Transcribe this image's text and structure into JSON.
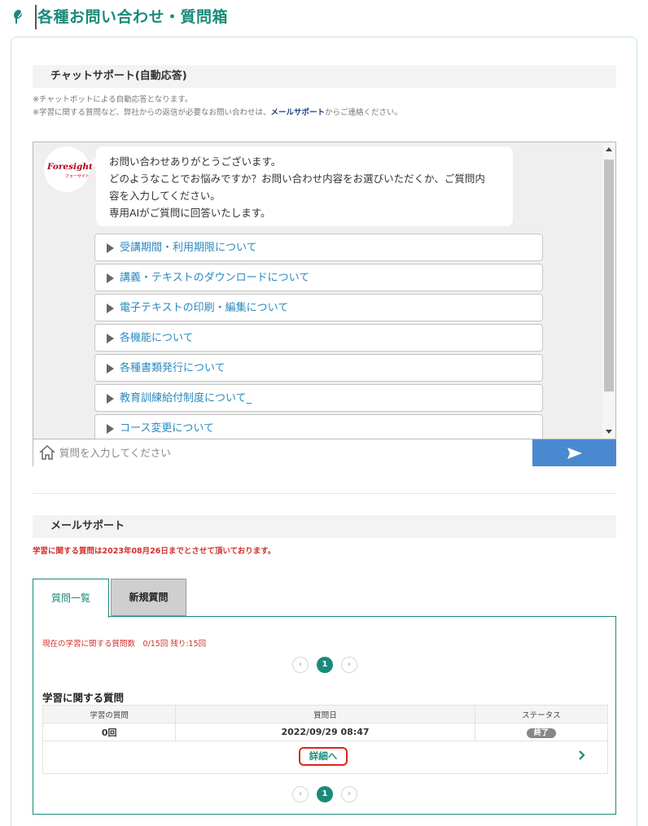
{
  "header": {
    "title": "各種お問い合わせ・質問箱",
    "icon": "leaf-icon",
    "accent_color": "#1a8a7a"
  },
  "chat_support": {
    "heading": "チャットサポート(自動応答)",
    "note_line1": "※チャットボットによる自動応答となります。",
    "note_line2_prefix": "※学習に関する質問など、弊社からの返信が必要なお問い合わせは、",
    "note_line2_link": "メールサポート",
    "note_line2_suffix": "からご連絡ください。",
    "bot": {
      "logo_text": "Foresight",
      "logo_sub": "フォーサイト",
      "messages": [
        "お問い合わせありがとうございます。",
        "どのようなことでお悩みですか？お問い合わせ内容をお選びいただくか、ご質問内",
        "容を入力してください。",
        "専用AIがご質問に回答いたします。"
      ]
    },
    "options": [
      "受講期間・利用期限について",
      "講義・テキストのダウンロードについて",
      "電子テキストの印刷・編集について",
      "各機能について",
      "各種書類発行について",
      "教育訓練給付制度について_",
      "コース変更について"
    ],
    "input": {
      "placeholder": "質問を入力してください",
      "value": ""
    },
    "send_color": "#4a89d0"
  },
  "mail_support": {
    "heading": "メールサポート",
    "deadline_note": "学習に関する質問は2023年08月26日までとさせて頂いております。",
    "tabs": [
      {
        "label": "質問一覧",
        "active": true
      },
      {
        "label": "新規質問",
        "active": false
      }
    ],
    "count_note": "現在の学習に関する質問数　0/15回 残り:15回",
    "pagination": {
      "prev": "‹",
      "current": "1",
      "next": "›"
    },
    "list_title": "学習に関する質問",
    "table": {
      "headers": [
        "学習の質問",
        "質問日",
        "ステータス"
      ],
      "rows": [
        {
          "count": "0回",
          "date": "2022/09/29 08:47",
          "status": "終了"
        }
      ]
    },
    "detail_label": "詳細へ"
  }
}
